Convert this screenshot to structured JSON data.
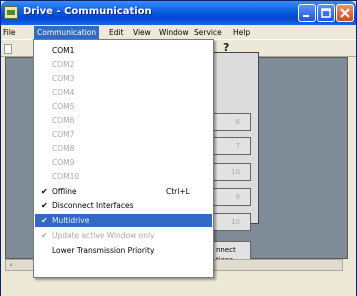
{
  "window": {
    "title": "Drive - Communication"
  },
  "menubar": [
    "File",
    "Communication",
    "Edit",
    "View",
    "Window",
    "Service",
    "Help"
  ],
  "toolbar": {
    "help_glyph": "?"
  },
  "dropdown": {
    "items": [
      {
        "label": "COM1",
        "enabled": true,
        "checked": false,
        "shortcut": ""
      },
      {
        "label": "COM2",
        "enabled": false,
        "checked": false,
        "shortcut": ""
      },
      {
        "label": "COM3",
        "enabled": false,
        "checked": false,
        "shortcut": ""
      },
      {
        "label": "COM4",
        "enabled": false,
        "checked": false,
        "shortcut": ""
      },
      {
        "label": "COM5",
        "enabled": false,
        "checked": false,
        "shortcut": ""
      },
      {
        "label": "COM6",
        "enabled": false,
        "checked": false,
        "shortcut": ""
      },
      {
        "label": "COM7",
        "enabled": false,
        "checked": false,
        "shortcut": ""
      },
      {
        "label": "COM8",
        "enabled": false,
        "checked": false,
        "shortcut": ""
      },
      {
        "label": "COM9",
        "enabled": false,
        "checked": false,
        "shortcut": ""
      },
      {
        "label": "COM10",
        "enabled": false,
        "checked": false,
        "shortcut": ""
      },
      {
        "label": "Offline",
        "enabled": true,
        "checked": true,
        "shortcut": "Ctrl+L"
      },
      {
        "label": "Disconnect Interfaces",
        "enabled": true,
        "checked": true,
        "shortcut": ""
      },
      {
        "label": "Multidrive",
        "enabled": true,
        "checked": true,
        "shortcut": "",
        "highlighted": true
      },
      {
        "label": "Update active Window only",
        "enabled": false,
        "checked": true,
        "shortcut": ""
      },
      {
        "label": "Lower Transmission Priority",
        "enabled": true,
        "checked": false,
        "shortcut": ""
      }
    ]
  },
  "side_buttons": [
    "6",
    "7",
    "10",
    "9",
    "10"
  ],
  "side_button_connect": {
    "line1": "nnect",
    "line2": "tions"
  },
  "checkmark_glyph": "✔",
  "colors": {
    "titlebar": "#0a5ce0",
    "highlight": "#316ac5",
    "workspace": "#7f8b97"
  }
}
